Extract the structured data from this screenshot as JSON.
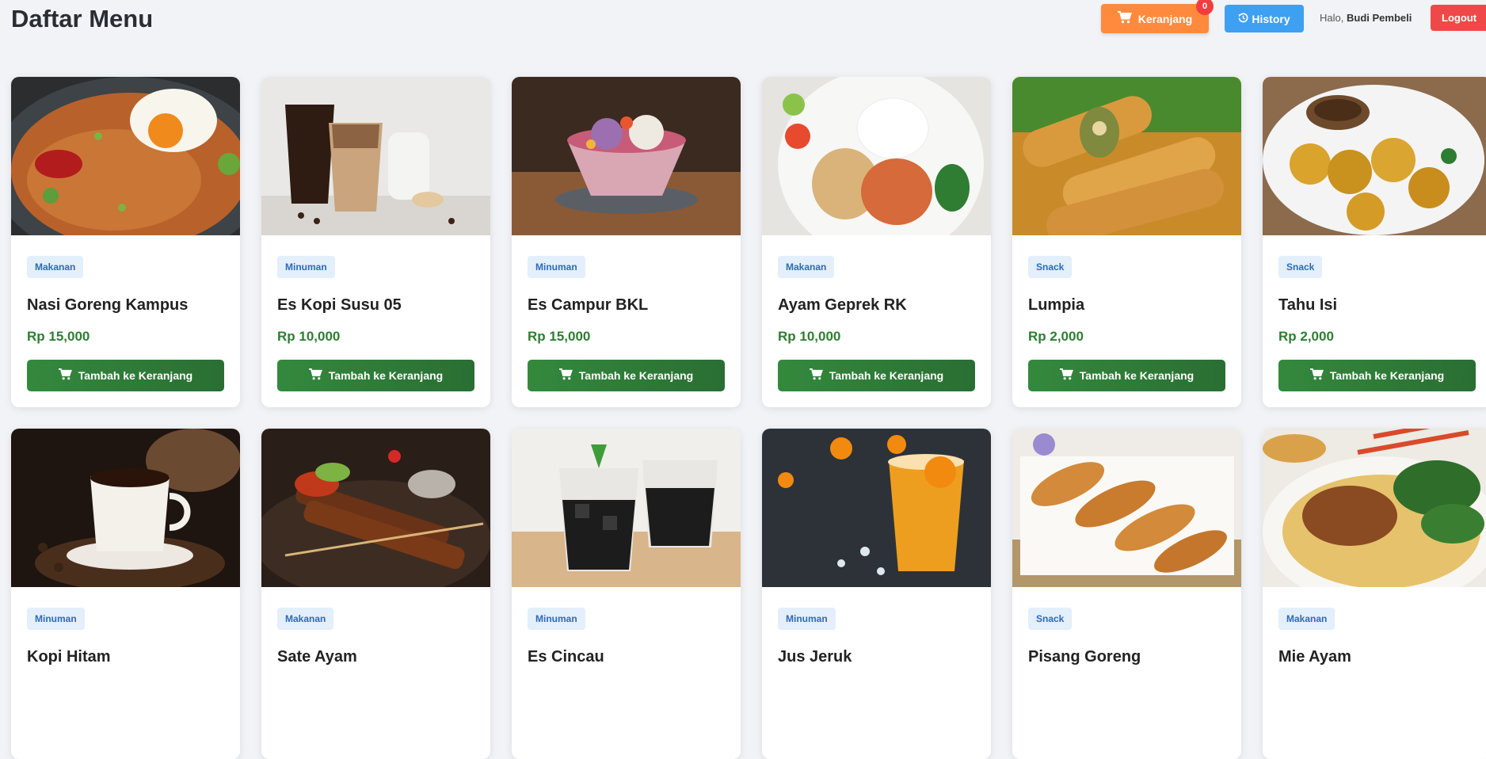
{
  "header": {
    "title": "Daftar Menu",
    "cart": {
      "label": "Keranjang",
      "icon": "cart-icon",
      "count": "0"
    },
    "history": {
      "label": "History",
      "icon": "history-icon"
    },
    "greeting": {
      "prefix": "Halo,",
      "user": "Budi Pembeli"
    },
    "logout_label": "Logout"
  },
  "colors": {
    "cart_button": "#ff8a3d",
    "history_button": "#3ea0f0",
    "logout_button": "#f04848",
    "add_button": "#2e7d32",
    "price": "#2e7d32",
    "badge_bg": "#e3effb",
    "badge_text": "#2d6ab8"
  },
  "add_button_label": "Tambah ke Keranjang",
  "products": [
    {
      "name": "Nasi Goreng Kampus",
      "category": "Makanan",
      "price": "Rp 15,000",
      "image": "fried-rice-photo"
    },
    {
      "name": "Es Kopi Susu 05",
      "category": "Minuman",
      "price": "Rp 10,000",
      "image": "iced-coffee-photo"
    },
    {
      "name": "Es Campur BKL",
      "category": "Minuman",
      "price": "Rp 15,000",
      "image": "es-campur-photo"
    },
    {
      "name": "Ayam Geprek RK",
      "category": "Makanan",
      "price": "Rp 10,000",
      "image": "ayam-geprek-photo"
    },
    {
      "name": "Lumpia",
      "category": "Snack",
      "price": "Rp 2,000",
      "image": "lumpia-photo"
    },
    {
      "name": "Tahu Isi",
      "category": "Snack",
      "price": "Rp 2,000",
      "image": "tahu-isi-photo"
    },
    {
      "name": "Kopi Hitam",
      "category": "Minuman",
      "price": "",
      "image": "black-coffee-photo"
    },
    {
      "name": "Sate Ayam",
      "category": "Makanan",
      "price": "",
      "image": "sate-photo"
    },
    {
      "name": "Es Cincau",
      "category": "Minuman",
      "price": "",
      "image": "es-cincau-photo"
    },
    {
      "name": "Jus Jeruk",
      "category": "Minuman",
      "price": "",
      "image": "orange-juice-photo"
    },
    {
      "name": "Pisang Goreng",
      "category": "Snack",
      "price": "",
      "image": "pisang-goreng-photo"
    },
    {
      "name": "Mie Ayam",
      "category": "Makanan",
      "price": "",
      "image": "mie-ayam-photo"
    }
  ]
}
